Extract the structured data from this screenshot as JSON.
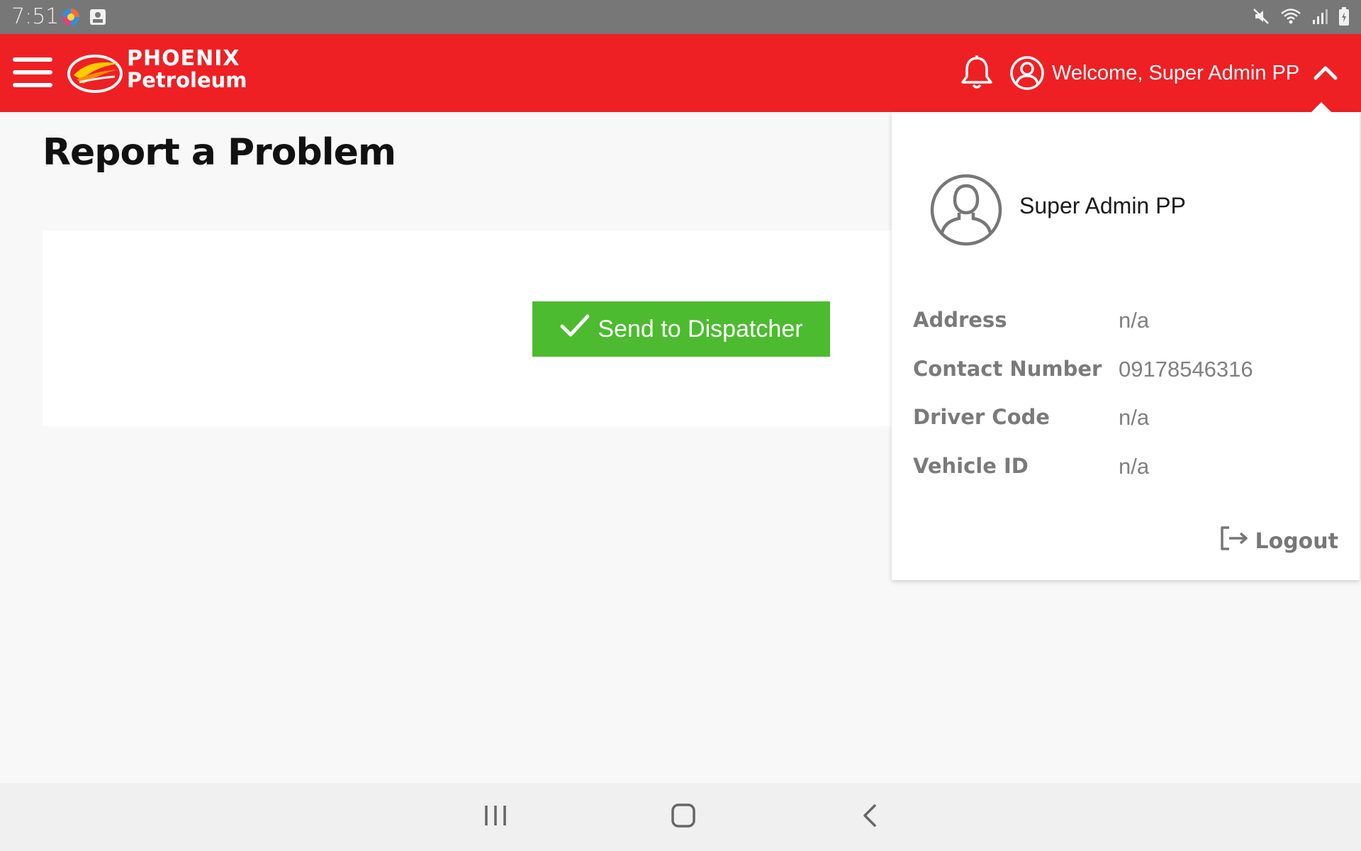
{
  "status_bar": {
    "time": "7:51",
    "icons": [
      "browser-app-icon",
      "photo-app-icon",
      "mute-icon",
      "wifi-icon",
      "signal-icon",
      "battery-icon"
    ]
  },
  "header": {
    "brand": {
      "line1": "PHOENIX",
      "line2": "Petroleum"
    },
    "welcome_text": "Welcome, Super Admin PP",
    "accent_color": "#ee2024"
  },
  "page": {
    "title": "Report a Problem",
    "send_button_label": "Send to Dispatcher",
    "button_color": "#4cbb2f"
  },
  "profile_dropdown": {
    "name": "Super Admin PP",
    "fields": [
      {
        "label": "Address",
        "value": "n/a"
      },
      {
        "label": "Contact Number",
        "value": "09178546316"
      },
      {
        "label": "Driver Code",
        "value": "n/a"
      },
      {
        "label": "Vehicle ID",
        "value": "n/a"
      }
    ],
    "logout_label": "Logout"
  },
  "nav_bar": {
    "buttons": [
      "recent-apps-icon",
      "home-icon",
      "back-icon"
    ]
  }
}
